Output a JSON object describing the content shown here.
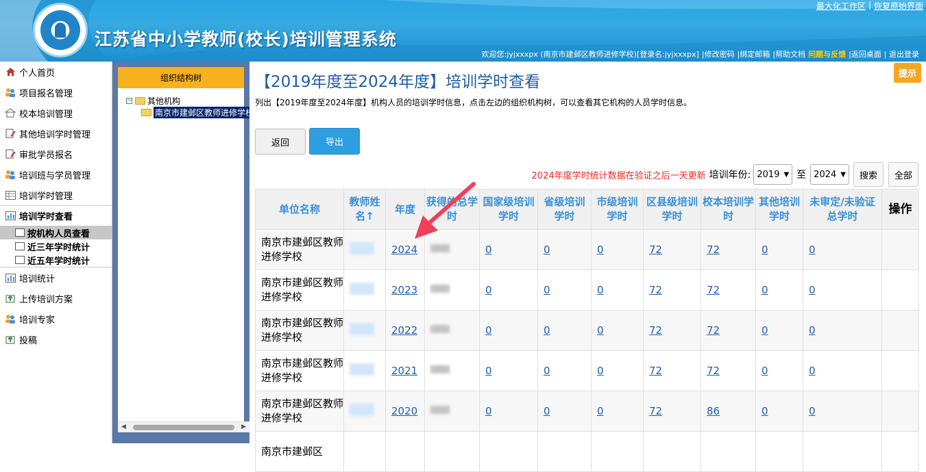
{
  "header": {
    "title": "江苏省中小学教师(校长)培训管理系统",
    "top_links": [
      "最大化工作区",
      "恢复原始界面"
    ],
    "welcome": "欢迎您:jyjxxxpx (南京市建邺区教师进修学校)[登录名:jyjxxxpx]",
    "user_links": [
      "|修改密码",
      "|绑定邮箱",
      "|帮助文档",
      "问题与反馈",
      "|返回桌面",
      "| 退出登录"
    ],
    "highlight_color": "#ffd200"
  },
  "sidebar": {
    "items": [
      {
        "label": "个人首页",
        "icon": "home-icon"
      },
      {
        "label": "项目报名管理",
        "icon": "users-icon"
      },
      {
        "label": "校本培训管理",
        "icon": "school-icon"
      },
      {
        "label": "其他培训学时管理",
        "icon": "doc-edit-icon"
      },
      {
        "label": "审批学员报名",
        "icon": "doc-edit-icon"
      },
      {
        "label": "培训班与学员管理",
        "icon": "users-icon"
      },
      {
        "label": "培训学时管理",
        "icon": "table-icon"
      }
    ],
    "group": {
      "label": "培训学时查看",
      "icon": "chart-icon"
    },
    "sub_items": [
      "按机构人员查看",
      "近三年学时统计",
      "近五年学时统计"
    ],
    "items_after": [
      {
        "label": "培训统计",
        "icon": "chart-icon"
      },
      {
        "label": "上传培训方案",
        "icon": "upload-icon"
      },
      {
        "label": "培训专家",
        "icon": "users-icon"
      },
      {
        "label": "投稿",
        "icon": "upload-icon"
      }
    ]
  },
  "tree": {
    "header": "组织结构树",
    "root": "其他机构",
    "child": "南京市建邺区教师进修学校"
  },
  "main": {
    "title": "【2019年度至2024年度】培训学时查看",
    "description": "列出【2019年度至2024年度】机构人员的培训学时信息，点击左边的组织机构树，可以查看其它机构的人员学时信息。",
    "hint_button": "提示",
    "back_button": "返回",
    "export_button": "导出",
    "notice": "2024年度学时统计数据在验证之后一天更新",
    "year_label": "培训年份:",
    "year_from": "2019",
    "year_to_label": "至",
    "year_to": "2024",
    "search_button": "搜索",
    "all_button": "全部"
  },
  "table": {
    "headers": [
      "单位名称",
      "教师姓名↑",
      "年度",
      "获得的总学时",
      "国家级培训学时",
      "省级培训学时",
      "市级培训学时",
      "区县级培训学时",
      "校本培训学时",
      "其他培训学时",
      "未审定/未验证总学时",
      "操作"
    ],
    "rows": [
      {
        "unit": "南京市建邺区教师进修学校",
        "year": "2024",
        "national": "0",
        "provincial": "0",
        "city": "0",
        "district": "72",
        "school": "72",
        "other": "0",
        "unverified": "0"
      },
      {
        "unit": "南京市建邺区教师进修学校",
        "year": "2023",
        "national": "0",
        "provincial": "0",
        "city": "0",
        "district": "72",
        "school": "72",
        "other": "0",
        "unverified": "0"
      },
      {
        "unit": "南京市建邺区教师进修学校",
        "year": "2022",
        "national": "0",
        "provincial": "0",
        "city": "0",
        "district": "72",
        "school": "72",
        "other": "0",
        "unverified": "0"
      },
      {
        "unit": "南京市建邺区教师进修学校",
        "year": "2021",
        "national": "0",
        "provincial": "0",
        "city": "0",
        "district": "72",
        "school": "72",
        "other": "0",
        "unverified": "0"
      },
      {
        "unit": "南京市建邺区教师进修学校",
        "year": "2020",
        "national": "0",
        "provincial": "0",
        "city": "0",
        "district": "72",
        "school": "86",
        "other": "0",
        "unverified": "0"
      },
      {
        "unit": "南京市建邺区",
        "year": "",
        "national": "",
        "provincial": "",
        "city": "",
        "district": "",
        "school": "",
        "other": "",
        "unverified": ""
      }
    ]
  },
  "colors": {
    "accent": "#1f5ca8",
    "header_text": "#3b8fd6",
    "notice": "#e8281e",
    "export": "#2d9ee0",
    "arrow": "#f0405a"
  }
}
